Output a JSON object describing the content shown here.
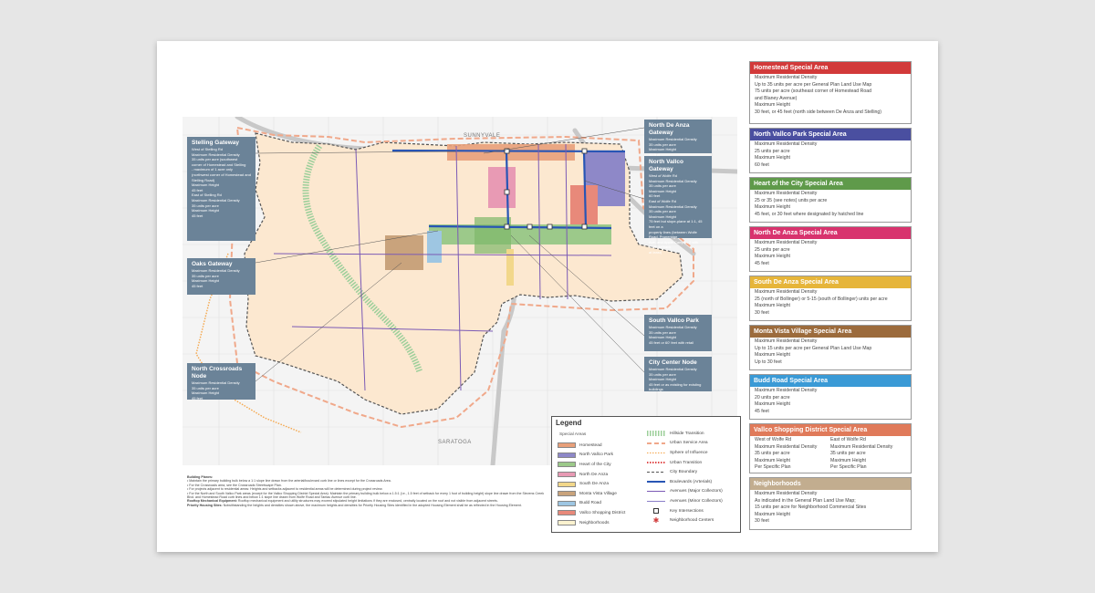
{
  "map": {
    "labels": {
      "sunnyvale": "SUNNYVALE",
      "saratoga": "SARATOGA"
    }
  },
  "callouts": {
    "stelling": {
      "title": "Stelling Gateway",
      "lines": [
        "West of Stelling Rd",
        "Maximum Residential Density",
        "35 units per acre (southwest",
        "corner of Homestead and Stelling",
        "- maximum of 1 acre only",
        "(northwest corner of Homestead and",
        "Stelling Road)",
        "Maximum Height",
        "45 feet",
        "East of Stelling Rd",
        "Maximum Residential Density",
        "35 units per acre",
        "Maximum Height",
        "45 feet"
      ]
    },
    "oaks": {
      "title": "Oaks Gateway",
      "lines": [
        "Maximum Residential Density",
        "35 units per acre",
        "Maximum Height",
        "45 feet"
      ]
    },
    "north_crossroads": {
      "title": "North Crossroads Node",
      "lines": [
        "Maximum Residential Density",
        "35 units per acre",
        "Maximum Height",
        "45 feet"
      ]
    },
    "north_de_anza": {
      "title": "North De Anza Gateway",
      "lines": [
        "Maximum Residential Density",
        "35 units per acre",
        "Maximum Height",
        "45 feet"
      ]
    },
    "north_vallco": {
      "title": "North Vallco Gateway",
      "lines": [
        "West of Wolfe Rd",
        "Maximum Residential Density",
        "35 units per acre",
        "Maximum Height",
        "60 feet",
        "East of Wolfe Rd",
        "Maximum Residential Density",
        "35 units per acre",
        "Maximum Height",
        "75 feet but slope-plane at 1:1, 45 feet on a",
        "property lines (between Wolfe Road, Pruneridge",
        "Ave. and Apple Campus 2 with small setback",
        "at least)"
      ]
    },
    "south_vallco": {
      "title": "South Vallco Park",
      "lines": [
        "Maximum Residential Density",
        "35 units per acre",
        "Maximum Height",
        "45 feet or 60' feet with retail"
      ]
    },
    "city_center": {
      "title": "City Center Node",
      "lines": [
        "Maximum Residential Density",
        "35 units per acre",
        "Maximum Height",
        "45 feet or as existing for existing buildings"
      ]
    }
  },
  "legend": {
    "title": "Legend",
    "special_areas_title": "Special Areas",
    "special_areas": [
      {
        "label": "Homestead",
        "color": "#e8a07a"
      },
      {
        "label": "North Vallco Park",
        "color": "#8e88c8"
      },
      {
        "label": "Heart of the City",
        "color": "#9cc98a"
      },
      {
        "label": "North De Anza",
        "color": "#e89ab4"
      },
      {
        "label": "South De Anza",
        "color": "#f2d78a"
      },
      {
        "label": "Monta Vista Village",
        "color": "#c9a37c"
      },
      {
        "label": "Budd Road",
        "color": "#9ec6e2"
      },
      {
        "label": "Vallco Shopping District",
        "color": "#e8897a"
      },
      {
        "label": "Neighborhoods",
        "color": "#fbf2cf"
      }
    ],
    "lines": [
      {
        "label": "Hillside Transition",
        "style": "hillside",
        "color": "#9ccf9a"
      },
      {
        "label": "Urban Service Area",
        "style": "dash-thick",
        "color": "#f0a88a"
      },
      {
        "label": "Sphere of Influence",
        "style": "dot",
        "color": "#f5a64a"
      },
      {
        "label": "Urban Transition",
        "style": "dot-red",
        "color": "#e04a4a"
      },
      {
        "label": "City Boundary",
        "style": "dash",
        "color": "#555555"
      },
      {
        "label": "Boulevards (Arterials)",
        "style": "solid-thick",
        "color": "#2855b5"
      },
      {
        "label": "Avenues (Major Collectors)",
        "style": "solid",
        "color": "#7b5ab5"
      },
      {
        "label": "Avenues (Minor Collectors)",
        "style": "solid-thin",
        "color": "#8a7ec8"
      },
      {
        "label": "Key Intersections",
        "style": "box",
        "color": "#333333"
      },
      {
        "label": "Neighborhood Centers",
        "style": "star",
        "color": "#d03a3a"
      }
    ]
  },
  "notes": {
    "heading": "Building Planes:",
    "bullets": [
      "Maintain the primary building bulk below a 1:1 slope line drawn from the arterial/boulevard curb line or lines except for the Crossroads Area.",
      "For the Crossroads area, see the Crossroads Streetscape Plan.",
      "For projects adjacent to residential areas: Heights and setbacks adjacent to residential areas will be determined during project review.",
      "For the North and South Vallco Park areas (except for the Vallco Shopping District Special Area): Maintain the primary building bulk below a 1.5:1 (i.e., 1.5 feet of setback for every 1 foot of building height) slope line drawn from the Stevens Creek Blvd. and Homestead Road curb lines and below 1:1 slope line drawn from Wolfe Road and Tantau Avenue curb line."
    ],
    "rooftop_label": "Rooftop Mechanical Equipment:",
    "rooftop_text": "Rooftop mechanical equipment and utility structures may exceed stipulated height limitations if they are enclosed, centrally located on the roof and not visible from adjacent streets.",
    "priority_label": "Priority Housing Sites:",
    "priority_text": "Notwithstanding the heights and densities shown above, the maximum heights and densities for Priority Housing Sites identified in the adopted Housing Element shall be as reflected in the Housing Element."
  },
  "panels": [
    {
      "id": "homestead",
      "title": "Homestead Special Area",
      "color": "#d23a3a",
      "lines": [
        "Maximum Residential Density",
        "Up to 35 units per acre per General Plan Land Use Map",
        "75 units per acre (southeast corner of Homestead Road",
        "and Blaney Avenue)",
        "Maximum Height",
        "30 feet, or 45 feet (north side between De Anza and Stelling)"
      ]
    },
    {
      "id": "north-vallco-park",
      "title": "North Vallco Park Special Area",
      "color": "#4a4fa0",
      "lines": [
        "Maximum Residential Density",
        "25 units per acre",
        "Maximum Height",
        "60 feet"
      ]
    },
    {
      "id": "heart-of-city",
      "title": "Heart of the City Special Area",
      "color": "#5f9a4a",
      "lines": [
        "Maximum Residential Density",
        "25 or 35 (see notes) units per acre",
        "Maximum Height",
        "45 feet, or 30 feet where designated by hatched line"
      ]
    },
    {
      "id": "north-de-anza",
      "title": "North De Anza Special Area",
      "color": "#d8336e",
      "lines": [
        "Maximum Residential Density",
        "25 units per acre",
        "Maximum Height",
        "45 feet"
      ]
    },
    {
      "id": "south-de-anza",
      "title": "South De Anza Special Area",
      "color": "#e6b53a",
      "lines": [
        "Maximum Residential Density",
        "25 (north of Bollinger) or 5-15 (south of Bollinger) units per acre",
        "Maximum Height",
        "30 feet"
      ]
    },
    {
      "id": "monta-vista",
      "title": "Monta Vista Village Special Area",
      "color": "#9c6b3c",
      "lines": [
        "Maximum Residential Density",
        "Up to 15 units per acre per General Plan Land Use Map",
        "Maximum Height",
        "Up to 30 feet"
      ]
    },
    {
      "id": "budd-road",
      "title": "Budd Road Special Area",
      "color": "#3a9ad6",
      "lines": [
        "Maximum Residential Density",
        "20 units per acre",
        "Maximum Height",
        "45 feet"
      ]
    },
    {
      "id": "vallco-shopping",
      "title": "Vallco Shopping District Special Area",
      "color": "#e07a5a",
      "two_col": true,
      "left": [
        "West of Wolfe Rd",
        "Maximum Residential Density",
        "35 units per acre",
        "Maximum Height",
        "Per Specific Plan"
      ],
      "right": [
        "East of Wolfe Rd",
        "Maximum Residential Density",
        "35 units per acre",
        "Maximum Height",
        "Per Specific Plan"
      ]
    },
    {
      "id": "neighborhoods",
      "title": "Neighborhoods",
      "color": "#c2ad8f",
      "lines": [
        "Maximum Residential Density",
        "As indicated in the General Plan Land Use Map;",
        "15 units per acre for Neighborhood Commercial Sites",
        "Maximum Height",
        "30 feet"
      ]
    }
  ]
}
